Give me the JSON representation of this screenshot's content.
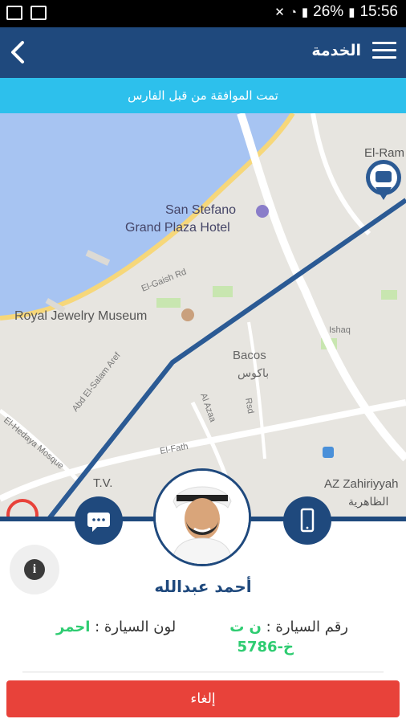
{
  "status_bar": {
    "battery": "26%",
    "time": "15:56"
  },
  "app_bar": {
    "title": "الخدمة",
    "back_icon": "back-arrow-icon",
    "menu_icon": "hamburger-menu-icon"
  },
  "banner": {
    "text": "تمت الموافقة من قبل الفارس"
  },
  "map": {
    "labels": {
      "el_ram": "El-Ram",
      "hotel_line1": "San Stefano",
      "hotel_line2": "Grand Plaza Hotel",
      "el_gaish": "El-Gaish Rd",
      "museum": "Royal Jewelry Museum",
      "ishaq": "Ishaq",
      "bacos_en": "Bacos",
      "bacos_ar": "باكوس",
      "abd_el_salam": "Abd El-Salam Aref",
      "el_hedaya": "El-Hedaya Mosque",
      "al_azaa": "Al Azaa",
      "rsd": "Rsd",
      "el_fath": "El-Fath",
      "tv": "T.V.",
      "az_zahiriyyah_en": "AZ Zahiriyyah",
      "az_zahiriyyah_ar": "الظاهرية"
    },
    "route_color": "#2b5a94",
    "car_marker_icon": "car-marker-icon"
  },
  "driver": {
    "name": "أحمد عبدالله",
    "avatar": "driver-avatar",
    "car_number_label": "رقم السيارة : ",
    "car_number_letters": "ن ت",
    "car_number_value": "خ-5786",
    "car_color_label": "لون السيارة : ",
    "car_color_value": "احمر"
  },
  "actions": {
    "chat_icon": "chat-bubble-icon",
    "phone_icon": "mobile-phone-icon",
    "info_icon": "info-icon",
    "cancel_label": "إلغاء"
  },
  "colors": {
    "primary": "#1f497d",
    "banner": "#2dc0ec",
    "cancel": "#e8423a",
    "accent_green": "#2ecc71"
  }
}
